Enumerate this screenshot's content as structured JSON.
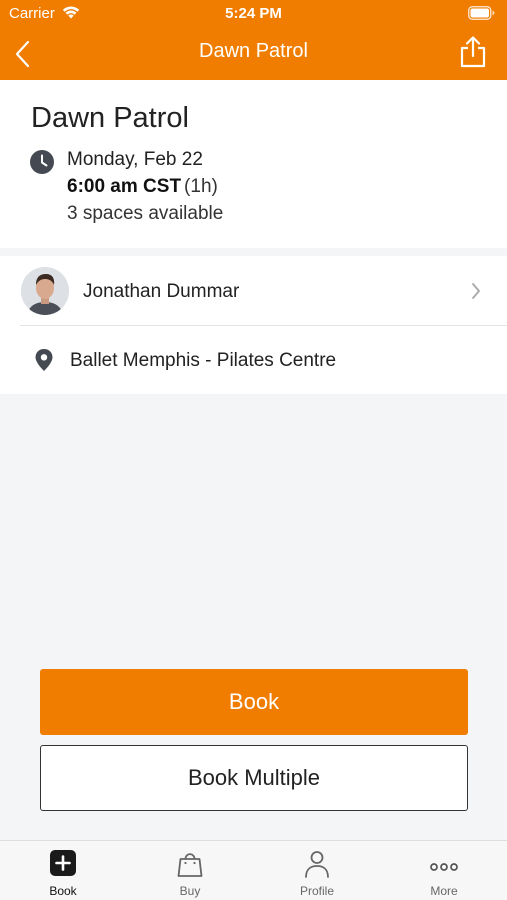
{
  "status_bar": {
    "carrier": "Carrier",
    "time": "5:24 PM"
  },
  "nav": {
    "title": "Dawn Patrol",
    "back_icon": "chevron-left-icon",
    "share_icon": "share-icon"
  },
  "class": {
    "title": "Dawn Patrol",
    "date": "Monday, Feb 22",
    "time": "6:00 am CST",
    "duration": "(1h)",
    "spaces": "3 spaces available"
  },
  "instructor": {
    "name": "Jonathan Dummar"
  },
  "location": {
    "name": "Ballet Memphis - Pilates Centre"
  },
  "actions": {
    "book_label": "Book",
    "book_multiple_label": "Book Multiple"
  },
  "tabs": [
    {
      "label": "Book",
      "icon": "plus-square-icon",
      "active": true
    },
    {
      "label": "Buy",
      "icon": "shopping-bag-icon",
      "active": false
    },
    {
      "label": "Profile",
      "icon": "person-icon",
      "active": false
    },
    {
      "label": "More",
      "icon": "more-dots-icon",
      "active": false
    }
  ],
  "colors": {
    "brand": "#f07d00",
    "background": "#f4f5f7"
  }
}
